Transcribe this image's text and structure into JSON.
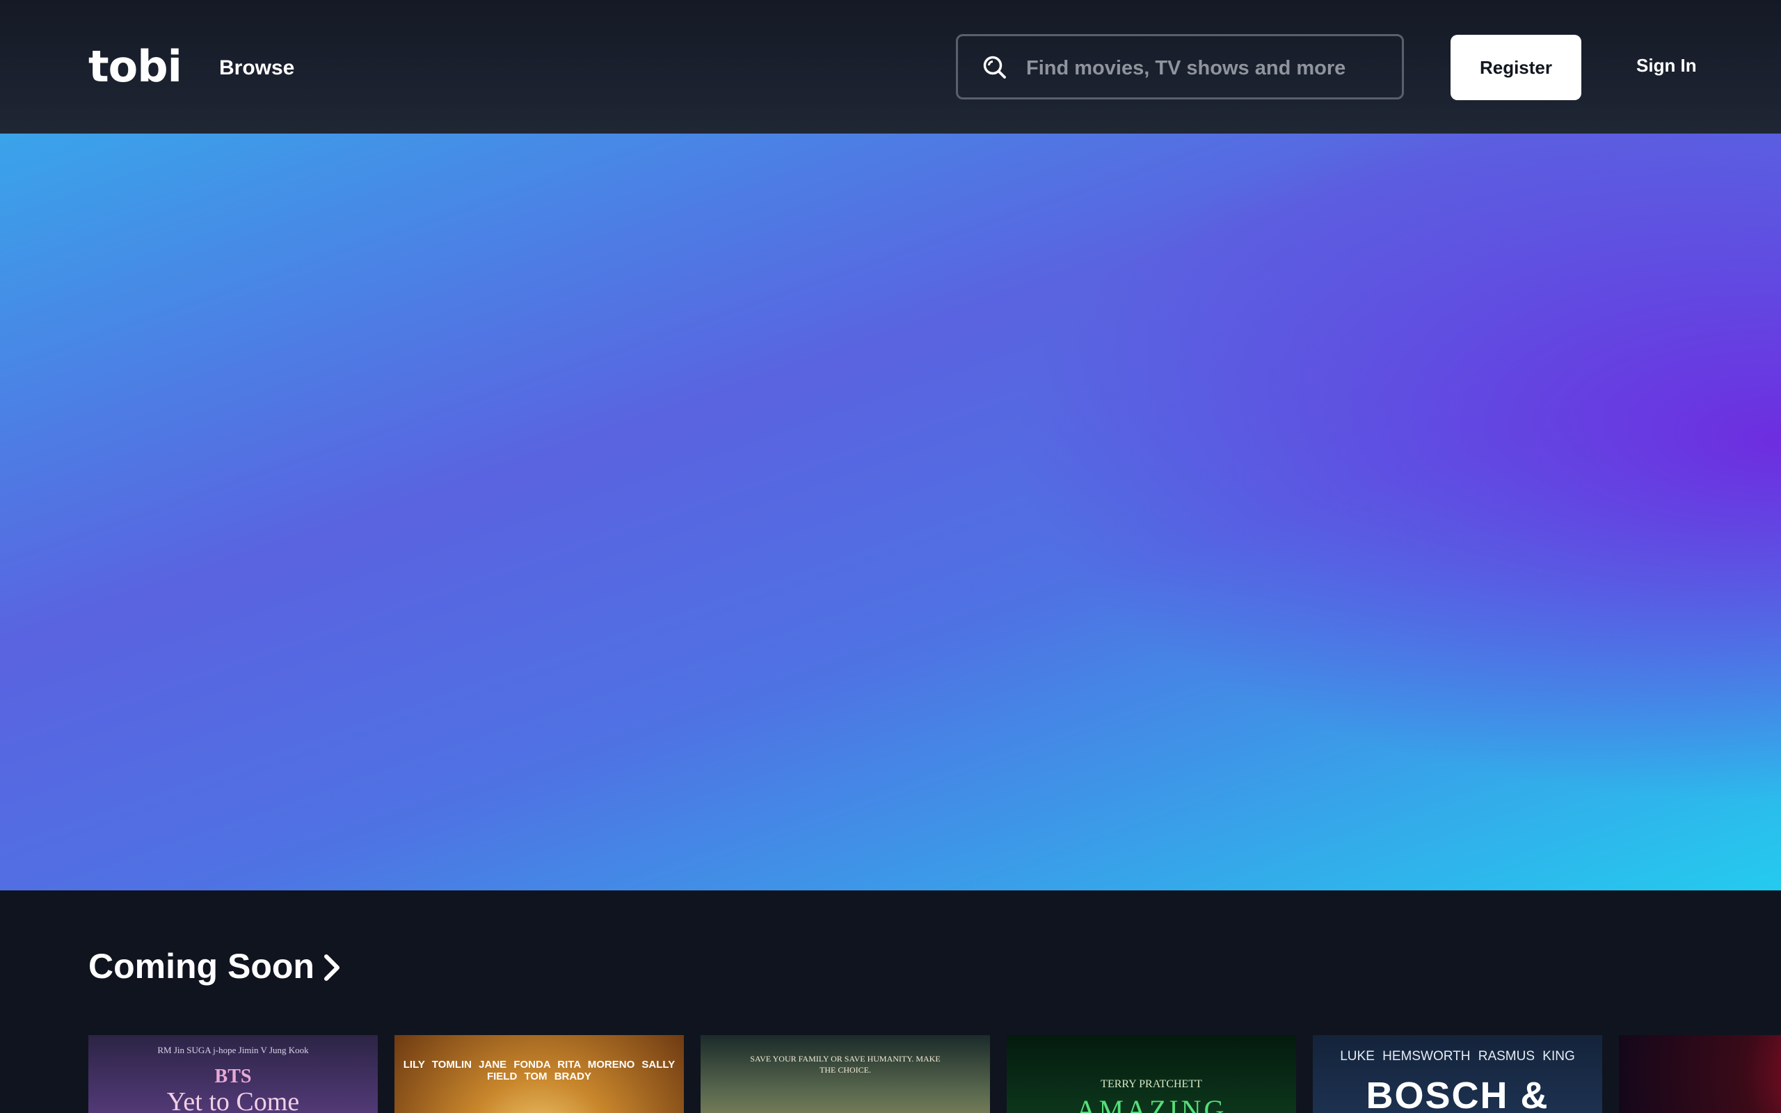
{
  "header": {
    "logo": "tobi",
    "nav_browse": "Browse",
    "search": {
      "placeholder": "Find movies, TV shows and more",
      "icon": "search-icon"
    },
    "register_label": "Register",
    "sign_in_label": "Sign In"
  },
  "hero": {
    "gradient_colors": [
      "#3aa4ea",
      "#5a63e0",
      "#7028e0",
      "#24cbee"
    ]
  },
  "coming_soon": {
    "title": "Coming Soon",
    "cards": [
      {
        "cast": "RM   Jin   SUGA   j-hope   Jimin   V   Jung Kook",
        "name": "BTS",
        "subtitle": "Yet to Come"
      },
      {
        "cast": "LILY TOMLIN   JANE FONDA   RITA MORENO   SALLY FIELD   TOM BRADY"
      },
      {
        "tagline": "SAVE YOUR FAMILY OR SAVE HUMANITY. MAKE THE CHOICE."
      },
      {
        "credit": "TERRY PRATCHETT",
        "title": "AMAZING"
      },
      {
        "cast": "LUKE HEMSWORTH   RASMUS KING",
        "title": "BOSCH & ROCKIT"
      },
      {}
    ]
  },
  "colors": {
    "background": "#10141f",
    "header": "#1a202c",
    "register_bg": "#ffffff"
  }
}
